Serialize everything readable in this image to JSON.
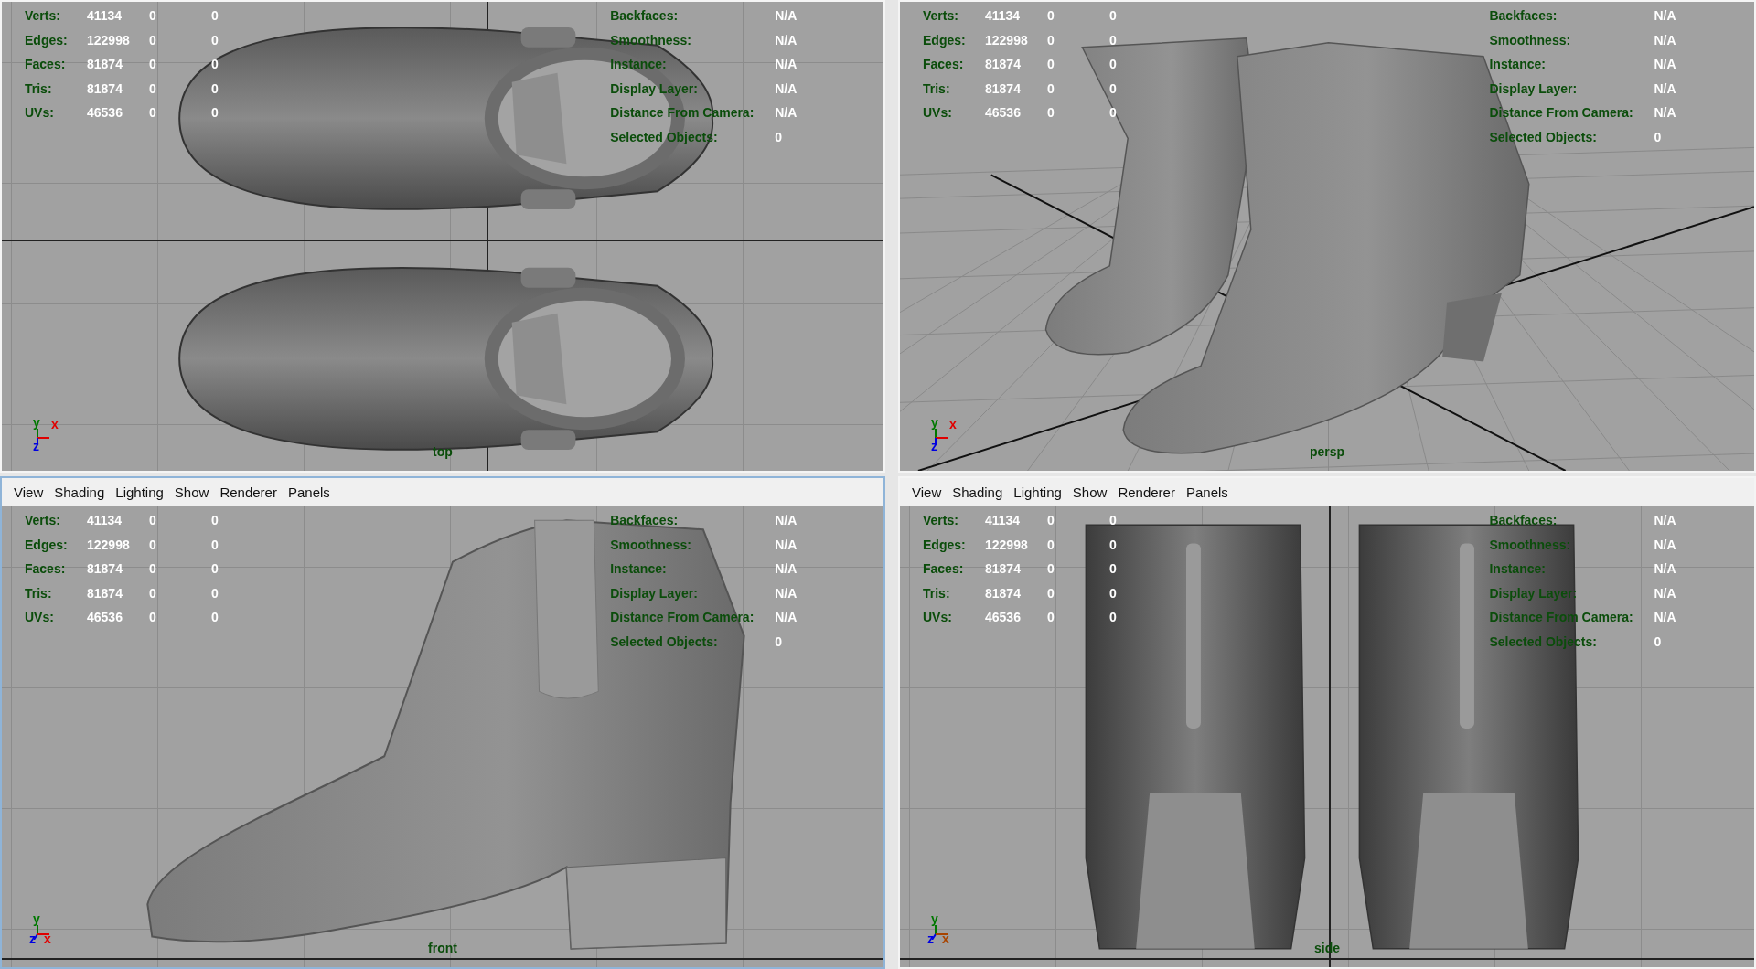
{
  "panels": [
    {
      "kind": "top",
      "camera": "top",
      "selected": false,
      "stats": [
        {
          "label": "Verts:",
          "values": [
            "41134",
            "0",
            "0"
          ]
        },
        {
          "label": "Edges:",
          "values": [
            "122998",
            "0",
            "0"
          ]
        },
        {
          "label": "Faces:",
          "values": [
            "81874",
            "0",
            "0"
          ]
        },
        {
          "label": "Tris:",
          "values": [
            "81874",
            "0",
            "0"
          ]
        },
        {
          "label": "UVs:",
          "values": [
            "46536",
            "0",
            "0"
          ]
        }
      ],
      "info": [
        {
          "label": "Backfaces:",
          "value": "N/A"
        },
        {
          "label": "Smoothness:",
          "value": "N/A"
        },
        {
          "label": "Instance:",
          "value": "N/A"
        },
        {
          "label": "Display Layer:",
          "value": "N/A"
        },
        {
          "label": "Distance From Camera:",
          "value": "N/A"
        },
        {
          "label": "Selected Objects:",
          "value": "0"
        }
      ],
      "axes": [
        {
          "label": "y",
          "kind": "up",
          "color": "#007800"
        },
        {
          "label": "x",
          "kind": "right",
          "color": "#e00000"
        },
        {
          "label": "z",
          "kind": "down",
          "color": "#0000e0"
        }
      ]
    },
    {
      "kind": "persp",
      "camera": "persp",
      "selected": false,
      "stats": [
        {
          "label": "Verts:",
          "values": [
            "41134",
            "0",
            "0"
          ]
        },
        {
          "label": "Edges:",
          "values": [
            "122998",
            "0",
            "0"
          ]
        },
        {
          "label": "Faces:",
          "values": [
            "81874",
            "0",
            "0"
          ]
        },
        {
          "label": "Tris:",
          "values": [
            "81874",
            "0",
            "0"
          ]
        },
        {
          "label": "UVs:",
          "values": [
            "46536",
            "0",
            "0"
          ]
        }
      ],
      "info": [
        {
          "label": "Backfaces:",
          "value": "N/A"
        },
        {
          "label": "Smoothness:",
          "value": "N/A"
        },
        {
          "label": "Instance:",
          "value": "N/A"
        },
        {
          "label": "Display Layer:",
          "value": "N/A"
        },
        {
          "label": "Distance From Camera:",
          "value": "N/A"
        },
        {
          "label": "Selected Objects:",
          "value": "0"
        }
      ],
      "axes": [
        {
          "label": "y",
          "kind": "up",
          "color": "#007800"
        },
        {
          "label": "x",
          "kind": "right",
          "color": "#e00000"
        },
        {
          "label": "z",
          "kind": "down",
          "color": "#0000e0"
        }
      ]
    },
    {
      "kind": "front",
      "camera": "front",
      "selected": true,
      "menu": [
        "View",
        "Shading",
        "Lighting",
        "Show",
        "Renderer",
        "Panels"
      ],
      "stats": [
        {
          "label": "Verts:",
          "values": [
            "41134",
            "0",
            "0"
          ]
        },
        {
          "label": "Edges:",
          "values": [
            "122998",
            "0",
            "0"
          ]
        },
        {
          "label": "Faces:",
          "values": [
            "81874",
            "0",
            "0"
          ]
        },
        {
          "label": "Tris:",
          "values": [
            "81874",
            "0",
            "0"
          ]
        },
        {
          "label": "UVs:",
          "values": [
            "46536",
            "0",
            "0"
          ]
        }
      ],
      "info": [
        {
          "label": "Backfaces:",
          "value": "N/A"
        },
        {
          "label": "Smoothness:",
          "value": "N/A"
        },
        {
          "label": "Instance:",
          "value": "N/A"
        },
        {
          "label": "Display Layer:",
          "value": "N/A"
        },
        {
          "label": "Distance From Camera:",
          "value": "N/A"
        },
        {
          "label": "Selected Objects:",
          "value": "0"
        }
      ],
      "axes": [
        {
          "label": "y",
          "kind": "up",
          "color": "#007800"
        },
        {
          "label": "z",
          "kind": "left",
          "color": "#0000e0"
        },
        {
          "label": "x",
          "kind": "right",
          "color": "#e00000"
        }
      ]
    },
    {
      "kind": "side",
      "camera": "side",
      "selected": false,
      "menu": [
        "View",
        "Shading",
        "Lighting",
        "Show",
        "Renderer",
        "Panels"
      ],
      "stats": [
        {
          "label": "Verts:",
          "values": [
            "41134",
            "0",
            "0"
          ]
        },
        {
          "label": "Edges:",
          "values": [
            "122998",
            "0",
            "0"
          ]
        },
        {
          "label": "Faces:",
          "values": [
            "81874",
            "0",
            "0"
          ]
        },
        {
          "label": "Tris:",
          "values": [
            "81874",
            "0",
            "0"
          ]
        },
        {
          "label": "UVs:",
          "values": [
            "46536",
            "0",
            "0"
          ]
        }
      ],
      "info": [
        {
          "label": "Backfaces:",
          "value": "N/A"
        },
        {
          "label": "Smoothness:",
          "value": "N/A"
        },
        {
          "label": "Instance:",
          "value": "N/A"
        },
        {
          "label": "Display Layer:",
          "value": "N/A"
        },
        {
          "label": "Distance From Camera:",
          "value": "N/A"
        },
        {
          "label": "Selected Objects:",
          "value": "0"
        }
      ],
      "axes": [
        {
          "label": "y",
          "kind": "up",
          "color": "#007800"
        },
        {
          "label": "z",
          "kind": "left",
          "color": "#0000e0"
        },
        {
          "label": "x",
          "kind": "right",
          "color": "#a84400"
        }
      ]
    }
  ]
}
